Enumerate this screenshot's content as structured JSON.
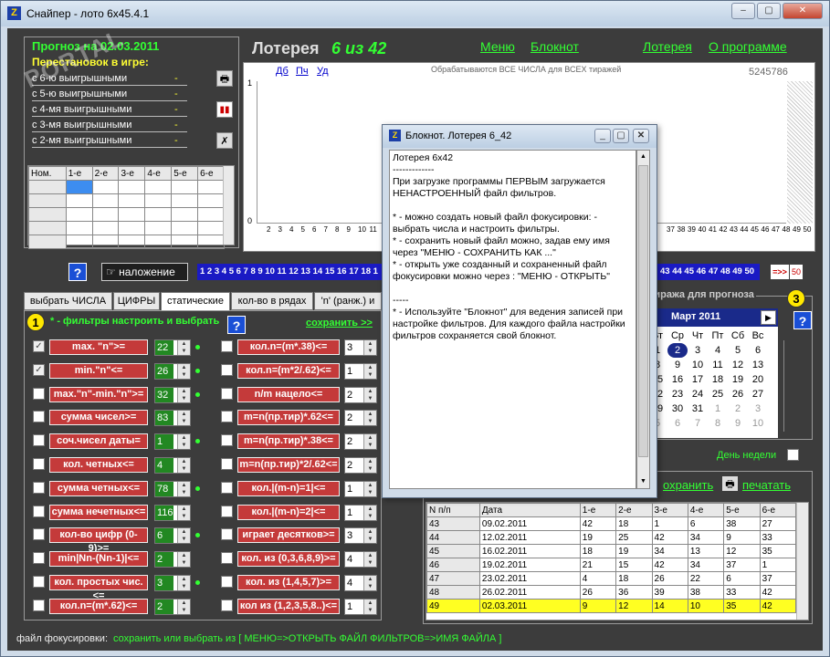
{
  "window": {
    "title": "Снайпер - лото 6x45.4.1",
    "min": "–",
    "max": "▢",
    "close": "✕"
  },
  "watermark": "PORTAL",
  "forecast": {
    "title": "Прогноз на 02.03.2011",
    "perm_label": "Перестановок в игре:",
    "rows": [
      {
        "label": "с 6-ю выигрышными",
        "val": "-"
      },
      {
        "label": "с 5-ю выигрышными",
        "val": "-"
      },
      {
        "label": "с 4-мя выигрышными",
        "val": "-"
      },
      {
        "label": "с 3-мя выигрышными",
        "val": "-"
      },
      {
        "label": "с 2-мя выигрышными",
        "val": "-"
      }
    ],
    "cols": [
      "Ном.",
      "1-е",
      "2-е",
      "3-е",
      "4-е",
      "5-е",
      "6-е"
    ]
  },
  "header": {
    "lottery": "Лотерея",
    "six": "6 из 42",
    "menu": "Меню",
    "notepad": "Блокнот",
    "lottery_link": "Лотерея",
    "about": "О программе"
  },
  "chart": {
    "btn_db": "Дб",
    "btn_pch": "Пч",
    "btn_ud": "Уд",
    "caption": "Обрабатываются ВСЕ ЧИСЛА для ВСЕХ тиражей",
    "count": "5245786",
    "y_top": "1",
    "y_zero": "0",
    "x_left": [
      "2",
      "3",
      "4",
      "5",
      "6",
      "7",
      "8",
      "9",
      "10",
      "11"
    ],
    "x_right": [
      "37",
      "38",
      "39",
      "40",
      "41",
      "42",
      "43",
      "44",
      "45",
      "46",
      "47",
      "48",
      "49",
      "50"
    ]
  },
  "strip": {
    "overlay": "наложение",
    "nums_left": "1 2 3 4 5 6 7 8 9 10 11 12 13 14 15 16 17 18 1",
    "nums_right": "43 44 45 46 47 48 49 50",
    "arrow": "=>>",
    "last": "50"
  },
  "tabs": [
    "выбрать ЧИСЛА",
    "ЦИФРЫ",
    "статические",
    "кол-во в рядах",
    "'n' (ранж.) и"
  ],
  "filters": {
    "step": "1",
    "hint": "* - фильтры настроить и выбрать",
    "save": "сохранить >>",
    "left": [
      {
        "label": "max. \"n\">=",
        "v": "22",
        "checked": "✓"
      },
      {
        "label": "min.\"n\"<=",
        "v": "26",
        "checked": "✓"
      },
      {
        "label": "max.\"n\"-min.\"n\">=",
        "v": "32",
        "checked": ""
      },
      {
        "label": "сумма чисел>=",
        "v": "83",
        "checked": ""
      },
      {
        "label": "соч.чисел даты=",
        "v": "1",
        "checked": ""
      },
      {
        "label": "кол. четных<=",
        "v": "4",
        "checked": ""
      },
      {
        "label": "сумма четных<=",
        "v": "78",
        "checked": ""
      },
      {
        "label": "сумма нечетных<=",
        "v": "116",
        "checked": ""
      },
      {
        "label": "кол-во цифр (0-9)>=",
        "v": "6",
        "checked": ""
      },
      {
        "label": "min|Nn-(Nn-1)|<=",
        "v": "2",
        "checked": ""
      },
      {
        "label": "кол. простых чис.<=",
        "v": "3",
        "checked": ""
      },
      {
        "label": "кол.n=(m*.62)<=",
        "v": "2",
        "checked": ""
      }
    ],
    "right": [
      {
        "label": "кол.n=(m*.38)<=",
        "v": "3"
      },
      {
        "label": "кол.n=(m*2/.62)<=",
        "v": "1"
      },
      {
        "label": "n/m нацело<=",
        "v": "2"
      },
      {
        "label": "m=n(пр.тир)*.62<=",
        "v": "2"
      },
      {
        "label": "m=n(пр.тир)*.38<=",
        "v": "2"
      },
      {
        "label": "m=n(пр.тир)*2/.62<=",
        "v": "2"
      },
      {
        "label": "кол.|(m-n)=1|<=",
        "v": "1"
      },
      {
        "label": "кол.|(m-n)=2|<=",
        "v": "1"
      },
      {
        "label": "играет десятков>=",
        "v": "3"
      },
      {
        "label": "кол. из (0,3,6,8,9)>=",
        "v": "4"
      },
      {
        "label": "кол. из (1,4,5,7)>=",
        "v": "4"
      },
      {
        "label": "кол из (1,2,3,5,8..)<=",
        "v": "1"
      }
    ]
  },
  "calendar": {
    "title": "тиража для прогноза",
    "step": "3",
    "month": "Март 2011",
    "next": "▶",
    "prev": "◀",
    "days": [
      "Вт",
      "Ср",
      "Чт",
      "Пт",
      "Сб",
      "Вс"
    ],
    "weeks": [
      [
        "1",
        "2",
        "3",
        "4",
        "5",
        "6"
      ],
      [
        "8",
        "9",
        "10",
        "11",
        "12",
        "13"
      ],
      [
        "15",
        "16",
        "17",
        "18",
        "19",
        "20"
      ],
      [
        "22",
        "23",
        "24",
        "25",
        "26",
        "27"
      ],
      [
        "29",
        "30",
        "31",
        "1",
        "2",
        "3"
      ],
      [
        "5",
        "6",
        "7",
        "8",
        "9",
        "10"
      ]
    ],
    "weekday": "День недели"
  },
  "results": {
    "save": "охранить",
    "print": "печатать",
    "cols": [
      "N п/п",
      "Дата",
      "1-е",
      "2-е",
      "3-е",
      "4-е",
      "5-е",
      "6-е"
    ],
    "rows": [
      [
        "43",
        "09.02.2011",
        "42",
        "18",
        "1",
        "6",
        "38",
        "27"
      ],
      [
        "44",
        "12.02.2011",
        "19",
        "25",
        "42",
        "34",
        "9",
        "33"
      ],
      [
        "45",
        "16.02.2011",
        "18",
        "19",
        "34",
        "13",
        "12",
        "35"
      ],
      [
        "46",
        "19.02.2011",
        "21",
        "15",
        "42",
        "34",
        "37",
        "1"
      ],
      [
        "47",
        "23.02.2011",
        "4",
        "18",
        "26",
        "22",
        "6",
        "37"
      ],
      [
        "48",
        "26.02.2011",
        "26",
        "36",
        "39",
        "38",
        "33",
        "42"
      ],
      [
        "49",
        "02.03.2011",
        "9",
        "12",
        "14",
        "10",
        "35",
        "42"
      ]
    ]
  },
  "footer": {
    "label": "файл фокусировки:",
    "text": "сохранить или выбрать из  [ МЕНЮ=>ОТКРЫТЬ ФАЙЛ ФИЛЬТРОВ=>ИМЯ ФАЙЛА ]"
  },
  "notepad": {
    "title": "Блокнот. Лотерея 6_42",
    "text": "Лотерея 6x42\n-------------\nПри загрузке программы ПЕРВЫМ загружается НЕНАСТРОЕННЫЙ файл фильтров.\n\n* - можно создать новый файл фокусировки: - выбрать числа и настроить фильтры.\n* - сохранить новый файл можно, задав ему имя через \"МЕНЮ - СОХРАНИТЬ КАК ...\"\n* - открыть уже созданный и сохраненный файл фокусировки можно через : \"МЕНЮ - ОТКРЫТЬ\"\n\n-----\n* - Используйте \"Блокнот\" для ведения записей при настройке фильтров. Для каждого файла настройки фильтров сохраняется свой блокнот."
  }
}
